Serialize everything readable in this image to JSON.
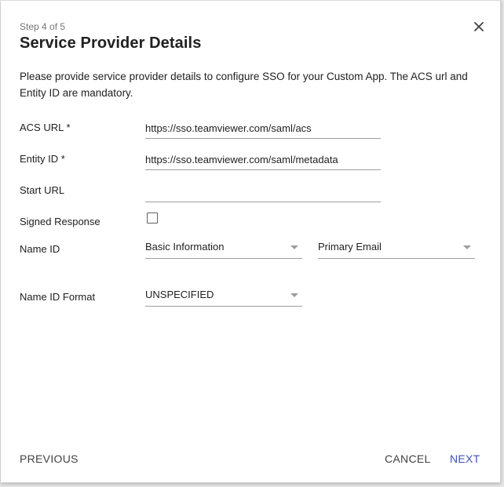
{
  "dialog": {
    "step": "Step 4 of 5",
    "title": "Service Provider Details",
    "description": "Please provide service provider details to configure SSO for your Custom App. The ACS url and Entity ID are mandatory."
  },
  "form": {
    "acs_url": {
      "label": "ACS URL *",
      "value": "https://sso.teamviewer.com/saml/acs"
    },
    "entity_id": {
      "label": "Entity ID *",
      "value": "https://sso.teamviewer.com/saml/metadata"
    },
    "start_url": {
      "label": "Start URL",
      "value": ""
    },
    "signed_response": {
      "label": "Signed Response",
      "checked": false
    },
    "name_id": {
      "label": "Name ID",
      "category": "Basic Information",
      "attribute": "Primary Email"
    },
    "name_id_format": {
      "label": "Name ID Format",
      "value": "UNSPECIFIED"
    }
  },
  "footer": {
    "previous": "PREVIOUS",
    "cancel": "CANCEL",
    "next": "NEXT"
  },
  "colors": {
    "primary": "#3f51b5",
    "text": "#212121",
    "secondary_text": "#757575",
    "divider": "#9e9e9e"
  },
  "icons": {
    "close": "close-icon",
    "dropdown": "chevron-down-icon"
  }
}
